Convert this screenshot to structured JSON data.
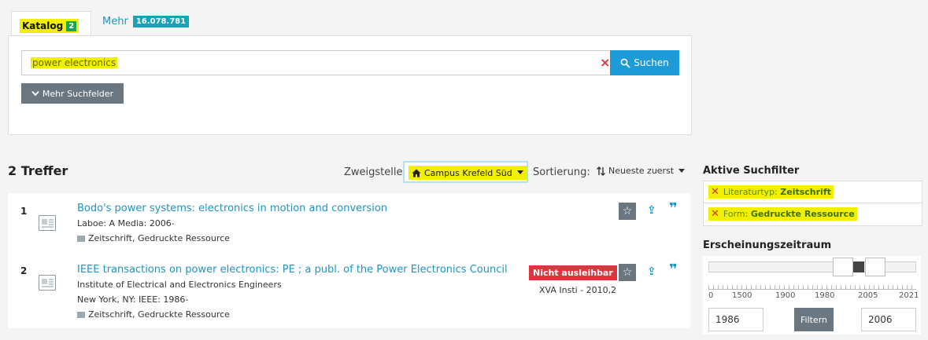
{
  "tabs": {
    "katalog_label": "Katalog",
    "katalog_count": "2",
    "mehr_label": "Mehr",
    "mehr_count": "16.078.781"
  },
  "search": {
    "value": "power electronics",
    "clear_icon": "×",
    "button_icon": "search-icon",
    "button_label": "Suchen",
    "more_fields_label": "Mehr Suchfelder"
  },
  "results_header": {
    "hits": "2 Treffer",
    "branch_label": "Zweigstelle:",
    "branch_value": "Campus Krefeld Süd",
    "sort_label": "Sortierung:",
    "sort_value": "Neueste zuerst"
  },
  "results": [
    {
      "num": "1",
      "title": "Bodo's power systems: electronics in motion and conversion",
      "line1": "Laboe: A Media: 2006-",
      "line2": "",
      "format": "Zeitschrift, Gedruckte Ressource",
      "status": "",
      "callnumber": ""
    },
    {
      "num": "2",
      "title": "IEEE transactions on power electronics: PE ; a publ. of the Power Electronics Council",
      "line1": "Institute of Electrical and Electronics Engineers",
      "line2": "New York, NY: IEEE: 1986-",
      "format": "Zeitschrift, Gedruckte Ressource",
      "status": "Nicht ausleihbar",
      "callnumber": "XVA Insti - 2010,2"
    }
  ],
  "sidebar": {
    "active_filters_title": "Aktive Suchfilter",
    "filters": [
      {
        "key": "Literaturtyp:",
        "value": "Zeitschrift"
      },
      {
        "key": "Form:",
        "value": "Gedruckte Ressource"
      }
    ],
    "timespan_title": "Erscheinungszeitraum",
    "tick_labels": [
      "0",
      "1500",
      "1900",
      "1980",
      "2005",
      "2021"
    ],
    "year_from": "1986",
    "year_to": "2006",
    "filter_button": "Filtern"
  },
  "colors": {
    "highlight": "#f2ef00",
    "link": "#1c94c6",
    "primary_button": "#1d9bd8",
    "danger": "#d9363e",
    "badge_green": "#16a35a",
    "badge_teal": "#17a2b8"
  }
}
